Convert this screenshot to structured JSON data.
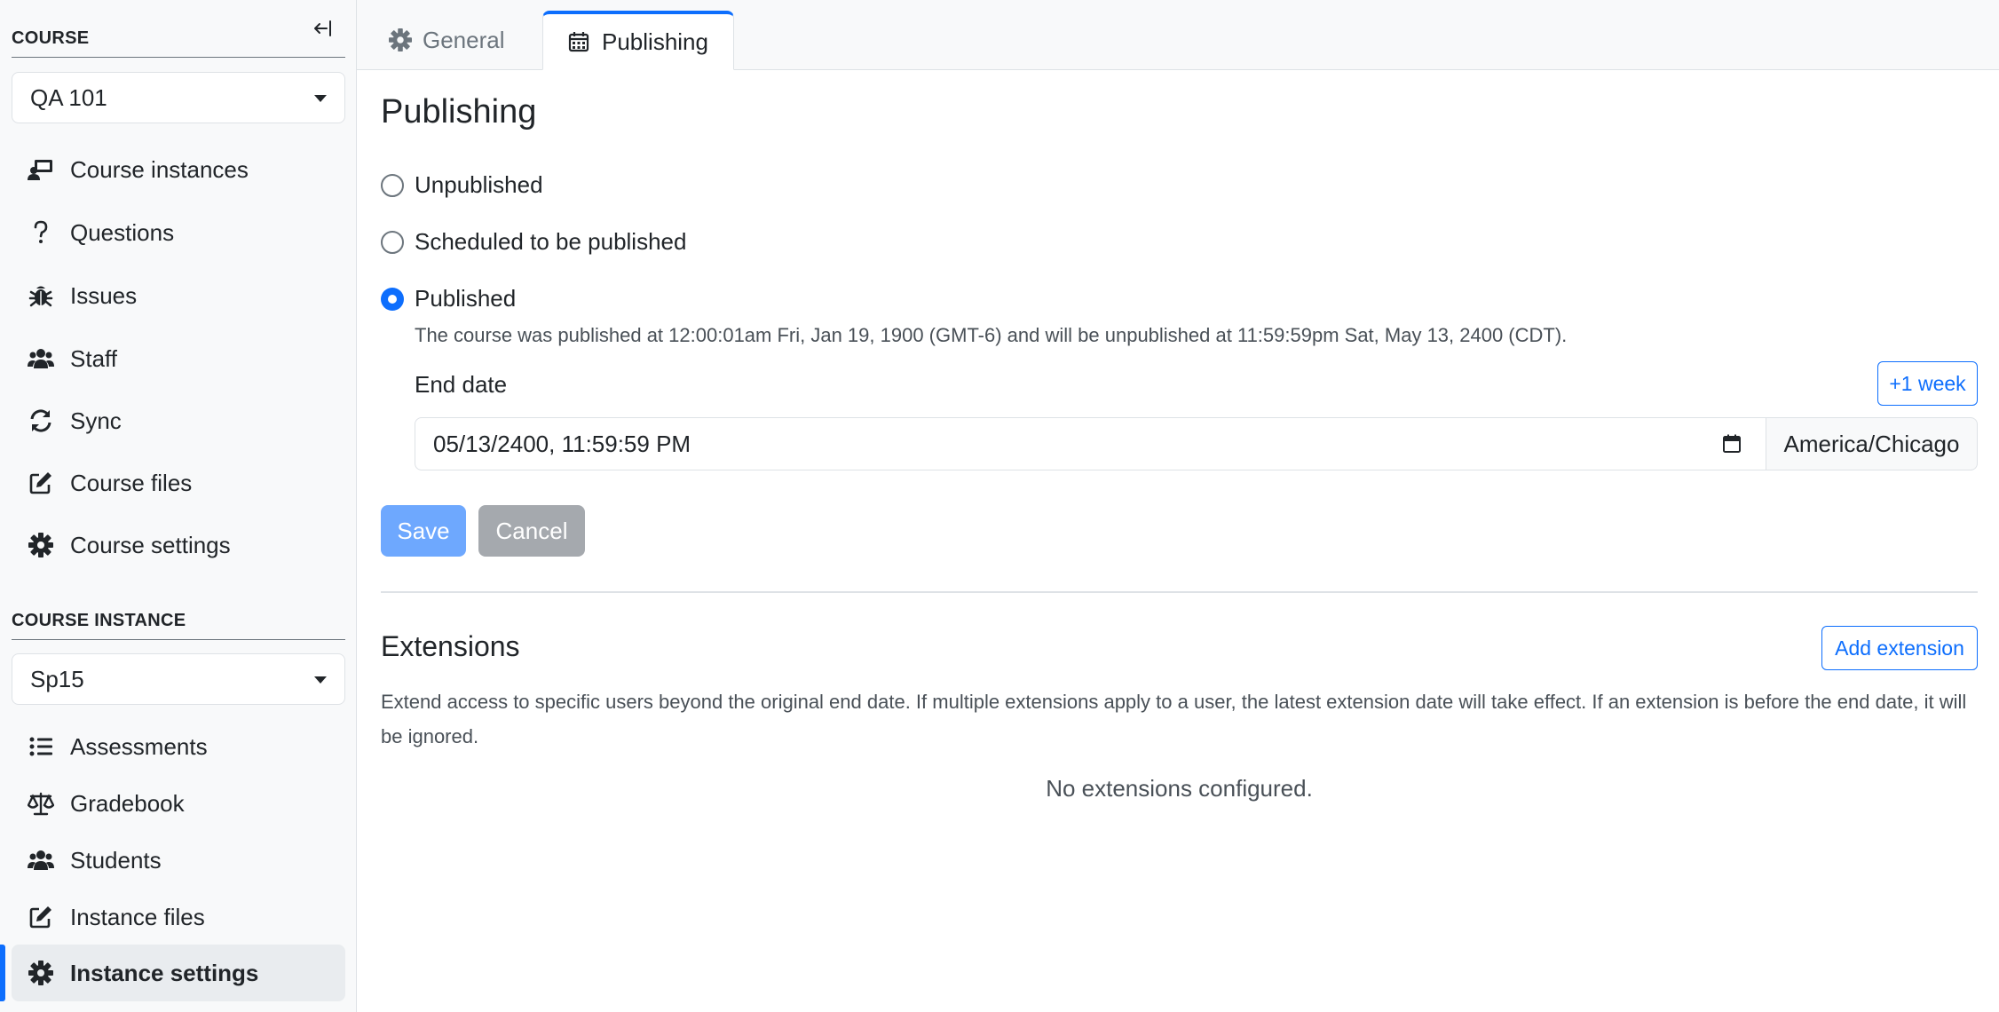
{
  "sidebar": {
    "course_heading": "COURSE",
    "course_select": "QA 101",
    "course_items": [
      {
        "label": "Course instances",
        "icon": "chalkboard-user-icon"
      },
      {
        "label": "Questions",
        "icon": "question-icon"
      },
      {
        "label": "Issues",
        "icon": "bug-icon"
      },
      {
        "label": "Staff",
        "icon": "users-icon"
      },
      {
        "label": "Sync",
        "icon": "sync-icon"
      },
      {
        "label": "Course files",
        "icon": "edit-icon"
      },
      {
        "label": "Course settings",
        "icon": "gear-icon"
      }
    ],
    "instance_heading": "COURSE INSTANCE",
    "instance_select": "Sp15",
    "instance_items": [
      {
        "label": "Assessments",
        "icon": "list-icon"
      },
      {
        "label": "Gradebook",
        "icon": "scale-icon"
      },
      {
        "label": "Students",
        "icon": "users-icon"
      },
      {
        "label": "Instance files",
        "icon": "edit-icon"
      },
      {
        "label": "Instance settings",
        "icon": "gear-icon",
        "active": true
      }
    ]
  },
  "tabs": [
    {
      "label": "General",
      "icon": "gear-icon"
    },
    {
      "label": "Publishing",
      "icon": "calendar-icon",
      "active": true
    }
  ],
  "publishing": {
    "title": "Publishing",
    "options": [
      {
        "label": "Unpublished",
        "checked": false
      },
      {
        "label": "Scheduled to be published",
        "checked": false
      },
      {
        "label": "Published",
        "checked": true
      }
    ],
    "description": "The course was published at 12:00:01am Fri, Jan 19, 1900 (GMT-6) and will be unpublished at 11:59:59pm Sat, May 13, 2400 (CDT).",
    "end_date_label": "End date",
    "plus_week": "+1 week",
    "end_date_value": "05/13/2400, 11:59:59 PM",
    "timezone": "America/Chicago",
    "save": "Save",
    "cancel": "Cancel"
  },
  "extensions": {
    "title": "Extensions",
    "add_button": "Add extension",
    "description": "Extend access to specific users beyond the original end date. If multiple extensions apply to a user, the latest extension date will take effect. If an extension is before the end date, it will be ignored.",
    "empty": "No extensions configured."
  },
  "colors": {
    "accent": "#0d6efd",
    "save_disabled": "#6ea8fe",
    "cancel": "#a5a9ae"
  }
}
